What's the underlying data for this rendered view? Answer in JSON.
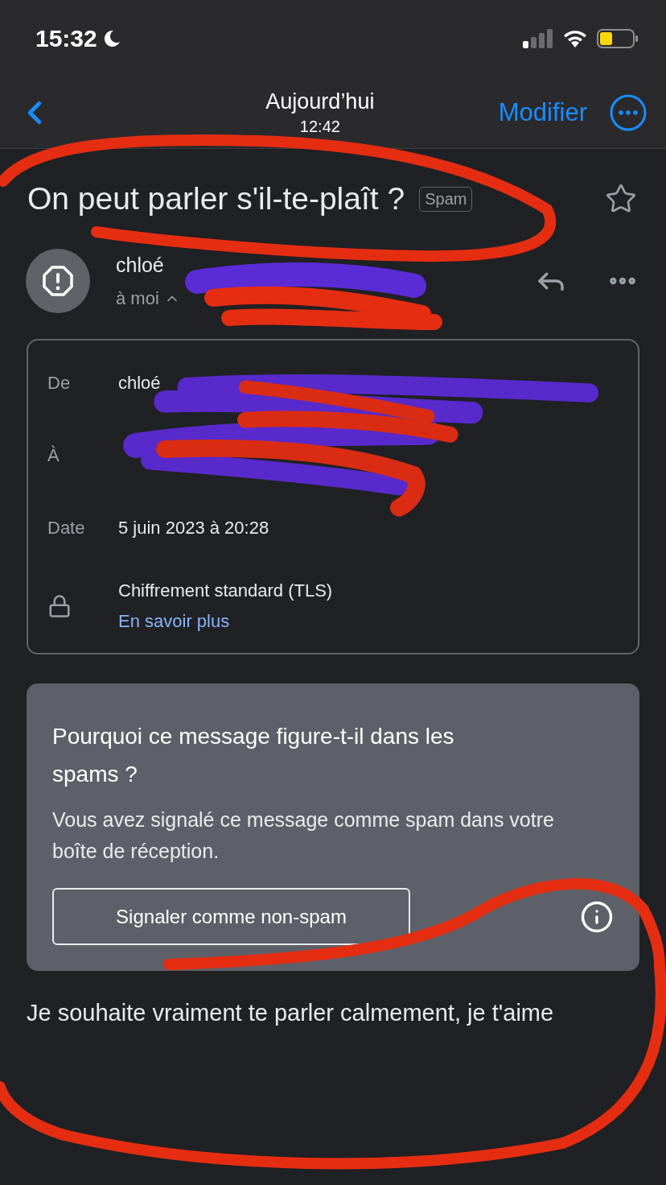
{
  "status_bar": {
    "time": "15:32"
  },
  "nav": {
    "title": "Aujourd’hui",
    "subtitle": "12:42",
    "edit": "Modifier"
  },
  "subject": {
    "title": "On peut parler s'il-te-plaît ?",
    "badge": "Spam",
    "starred": false
  },
  "sender": {
    "name": "chloé",
    "recipient": "à moi",
    "expanded": true
  },
  "details": {
    "rows": [
      {
        "label": "De",
        "value": "chloé"
      },
      {
        "label": "À"
      },
      {
        "label": "Date",
        "value": "5 juin 2023 à 20:28"
      }
    ],
    "encryption": "Chiffrement standard (TLS)",
    "link": "En savoir plus"
  },
  "spam_notice": {
    "title": "Pourquoi ce message figure-t-il dans les spams ?",
    "text": "Vous avez signalé ce message comme spam dans votre boîte de réception.",
    "button": "Signaler comme non-spam"
  },
  "body": "Je souhaite vraiment te parler calmement, je t'aime"
}
